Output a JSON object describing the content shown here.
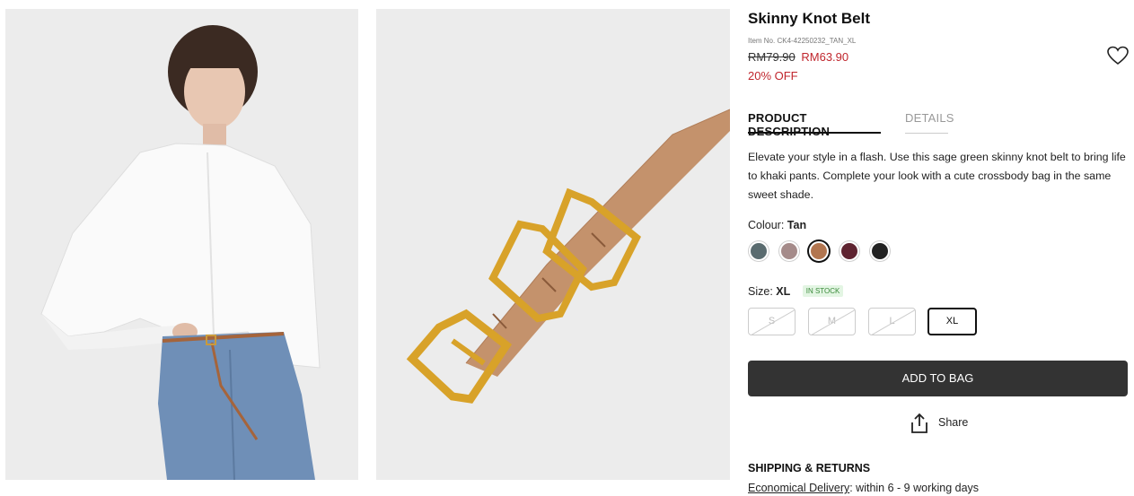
{
  "product": {
    "title": "Skinny Knot Belt",
    "item_no": "Item No. CK4-42250232_TAN_XL",
    "old_price": "RM79.90",
    "new_price": "RM63.90",
    "discount": "20% OFF"
  },
  "tabs": {
    "description": "PRODUCT DESCRIPTION",
    "details": "DETAILS"
  },
  "description": "Elevate your style in a flash. Use this sage green skinny knot belt to bring life to khaki pants. Complete your look with a cute crossbody bag in the same sweet shade.",
  "colour": {
    "label": "Colour:",
    "selected": "Tan",
    "swatches": [
      {
        "name": "slate",
        "hex": "#5a6b6f"
      },
      {
        "name": "mauve",
        "hex": "#a58b8a"
      },
      {
        "name": "tan",
        "hex": "#b27650",
        "selected": true
      },
      {
        "name": "burgundy",
        "hex": "#5e2330"
      },
      {
        "name": "black",
        "hex": "#222222"
      }
    ]
  },
  "size": {
    "label": "Size:",
    "selected": "XL",
    "stock": "IN STOCK",
    "options": [
      {
        "label": "S",
        "available": false
      },
      {
        "label": "M",
        "available": false
      },
      {
        "label": "L",
        "available": false
      },
      {
        "label": "XL",
        "available": true,
        "selected": true
      }
    ]
  },
  "add_to_bag": "ADD TO BAG",
  "share": "Share",
  "shipping": {
    "title": "SHIPPING & RETURNS",
    "delivery_link": "Economical Delivery",
    "delivery_text": ": within 6 - 9 working days"
  },
  "colors": {
    "price_red": "#c0262d",
    "button_dark": "#333333"
  }
}
